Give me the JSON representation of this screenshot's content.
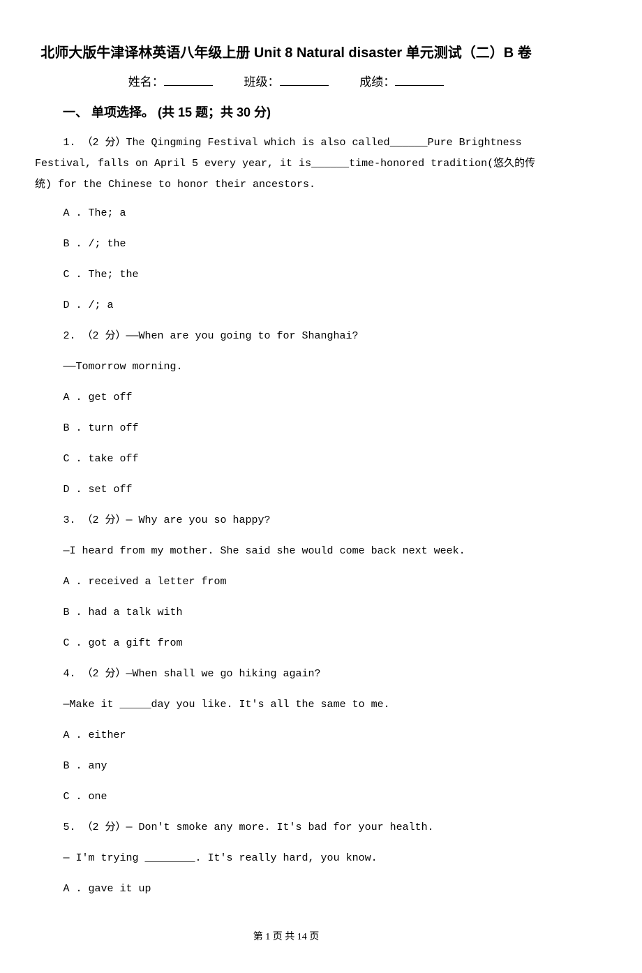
{
  "title": "北师大版牛津译林英语八年级上册 Unit 8 Natural disaster 单元测试（二）B 卷",
  "meta": {
    "name_label": "姓名：",
    "class_label": "班级：",
    "score_label": "成绩："
  },
  "section1": {
    "header": "一、 单项选择。  (共 15 题；共 30 分)"
  },
  "q1": {
    "stem": "1.  （2 分）The Qingming Festival which is also called______Pure Brightness Festival, falls on April 5 every year, it is______time-honored tradition(悠久的传统) for the Chinese to honor their ancestors.",
    "A": "A . The; a",
    "B": "B . /; the",
    "C": "C . The; the",
    "D": "D . /; a"
  },
  "q2": {
    "stem": "2.  （2 分）——When are you going to             for Shanghai?",
    "line2": "——Tomorrow morning.",
    "A": "A . get off",
    "B": "B . turn off",
    "C": "C . take off",
    "D": "D . set off"
  },
  "q3": {
    "stem": "3.  （2 分）— Why are you so happy?",
    "line2": "—I heard from my mother. She said she would come back next week.",
    "A": "A .         received a letter from",
    "B": "B .         had a talk with",
    "C": "C .         got a gift from"
  },
  "q4": {
    "stem": "4.  （2 分）—When shall we go hiking again?",
    "line2": "—Make it _____day you like. It's all the same to me.",
    "A": "A . either",
    "B": "B . any",
    "C": "C . one"
  },
  "q5": {
    "stem": "5.  （2 分）— Don't smoke any more. It's bad for your health.",
    "line2": "— I'm trying ________. It's really hard, you know.",
    "A": "A . gave it up"
  },
  "footer": "第 1 页 共 14 页"
}
